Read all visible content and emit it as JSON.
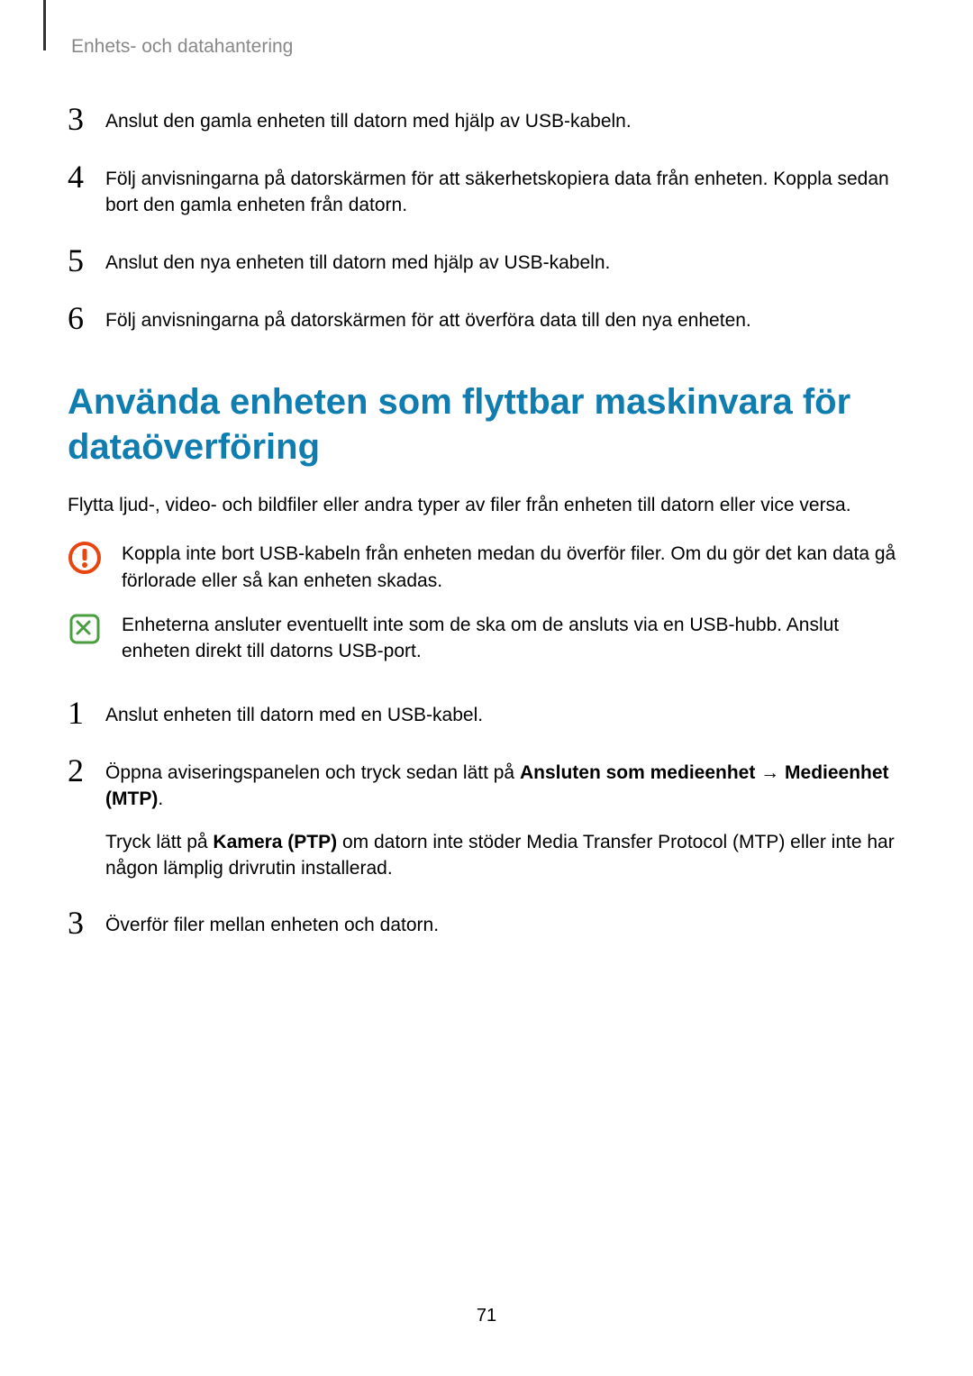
{
  "header": "Enhets- och datahantering",
  "list1": {
    "item3": {
      "num": "3",
      "text": "Anslut den gamla enheten till datorn med hjälp av USB-kabeln."
    },
    "item4": {
      "num": "4",
      "text": "Följ anvisningarna på datorskärmen för att säkerhetskopiera data från enheten. Koppla sedan bort den gamla enheten från datorn."
    },
    "item5": {
      "num": "5",
      "text": "Anslut den nya enheten till datorn med hjälp av USB-kabeln."
    },
    "item6": {
      "num": "6",
      "text": "Följ anvisningarna på datorskärmen för att överföra data till den nya enheten."
    }
  },
  "section_title": "Använda enheten som flyttbar maskinvara för dataöverföring",
  "intro": "Flytta ljud-, video- och bildfiler eller andra typer av filer från enheten till datorn eller vice versa.",
  "warning": "Koppla inte bort USB-kabeln från enheten medan du överför filer. Om du gör det kan data gå förlorade eller så kan enheten skadas.",
  "note": "Enheterna ansluter eventuellt inte som de ska om de ansluts via en USB-hubb. Anslut enheten direkt till datorns USB-port.",
  "list2": {
    "item1": {
      "num": "1",
      "text": "Anslut enheten till datorn med en USB-kabel."
    },
    "item2": {
      "num": "2",
      "part1": "Öppna aviseringspanelen och tryck sedan lätt på ",
      "bold1": "Ansluten som medieenhet",
      "arrow": " → ",
      "bold2": "Medieenhet (MTP)",
      "period": ".",
      "sub1": "Tryck lätt på ",
      "subBold": "Kamera (PTP)",
      "sub2": " om datorn inte stöder Media Transfer Protocol (MTP) eller inte har någon lämplig drivrutin installerad."
    },
    "item3": {
      "num": "3",
      "text": "Överför filer mellan enheten och datorn."
    }
  },
  "page_number": "71"
}
